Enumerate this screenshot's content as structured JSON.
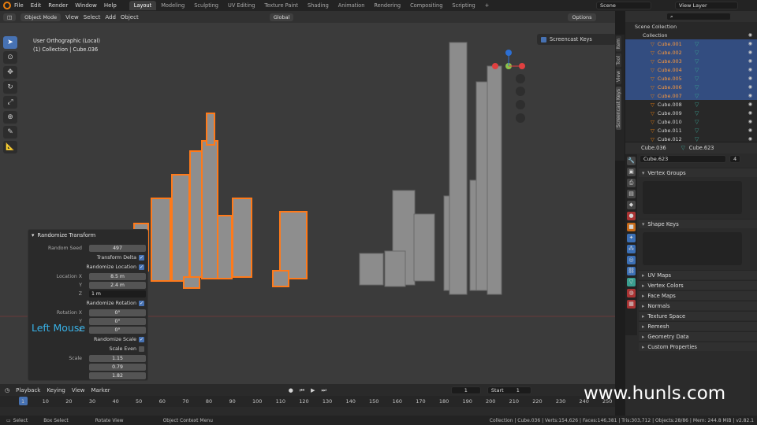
{
  "topbar": {
    "menus": [
      "File",
      "Edit",
      "Render",
      "Window",
      "Help"
    ],
    "workspaces": [
      "Layout",
      "Modeling",
      "Sculpting",
      "UV Editing",
      "Texture Paint",
      "Shading",
      "Animation",
      "Rendering",
      "Compositing",
      "Scripting"
    ],
    "active_workspace": "Layout",
    "scene": "Scene",
    "view_layer": "View Layer"
  },
  "viewport_header": {
    "mode": "Object Mode",
    "menus": [
      "View",
      "Select",
      "Add",
      "Object"
    ],
    "orientation": "Global",
    "options": "Options"
  },
  "overlay": {
    "view_name": "User Orthographic (Local)",
    "collection": "(1) Collection | Cube.036"
  },
  "n_panel": {
    "screencast_keys": "Screencast Keys"
  },
  "side_tabs": [
    "Item",
    "Tool",
    "View",
    "Screencast Keys"
  ],
  "redo_panel": {
    "title": "Randomize Transform",
    "random_seed_label": "Random Seed",
    "random_seed": "497",
    "transform_delta": "Transform Delta",
    "randomize_location": "Randomize Location",
    "location_x_label": "Location X",
    "location_x": "8.5 m",
    "location_y_label": "Y",
    "location_y": "2.4 m",
    "location_z_label": "Z",
    "location_z": "1 m",
    "randomize_rotation": "Randomize Rotation",
    "rotation_x_label": "Rotation X",
    "rotation_x": "0°",
    "rotation_y_label": "Y",
    "rotation_y": "0°",
    "rotation_z_label": "Z",
    "rotation_z": "0°",
    "randomize_scale": "Randomize Scale",
    "scale_even": "Scale Even",
    "scale_label": "Scale",
    "scale_x": "1.15",
    "scale_y": "0.79",
    "scale_z": "1.82"
  },
  "key_overlay": "Left Mouse",
  "outliner": {
    "root": "Scene Collection",
    "collection": "Collection",
    "items": [
      "Cube.001",
      "Cube.002",
      "Cube.003",
      "Cube.004",
      "Cube.005",
      "Cube.006",
      "Cube.007",
      "Cube.008",
      "Cube.009",
      "Cube.010",
      "Cube.011",
      "Cube.012"
    ],
    "selected_count": 7
  },
  "properties": {
    "object": "Cube.036",
    "mesh": "Cube.623",
    "datablock": "Cube.623",
    "users": "4",
    "panels": [
      "Vertex Groups",
      "Shape Keys",
      "UV Maps",
      "Vertex Colors",
      "Face Maps",
      "Normals",
      "Texture Space",
      "Remesh",
      "Geometry Data",
      "Custom Properties"
    ]
  },
  "timeline": {
    "menus": [
      "Playback",
      "Keying",
      "View",
      "Marker"
    ],
    "current_frame": "1",
    "start_label": "Start",
    "start": "1",
    "ticks": [
      "1",
      "10",
      "20",
      "30",
      "40",
      "50",
      "60",
      "70",
      "80",
      "90",
      "100",
      "110",
      "120",
      "130",
      "140",
      "150",
      "160",
      "170",
      "180",
      "190",
      "200",
      "210",
      "220",
      "230",
      "240",
      "250"
    ]
  },
  "statusbar": {
    "select": "Select",
    "box_select": "Box Select",
    "rotate_view": "Rotate View",
    "context_menu": "Object Context Menu",
    "stats": "Collection | Cube.036 | Verts:154,626 | Faces:146,381 | Tris:303,712 | Objects:28/86 | Mem: 244.8 MiB | v2.82.1"
  },
  "watermark": "www.hunls.com",
  "colors": {
    "accent": "#4772b3",
    "selection": "#ff7a1a",
    "key_overlay": "#38b2e8"
  }
}
